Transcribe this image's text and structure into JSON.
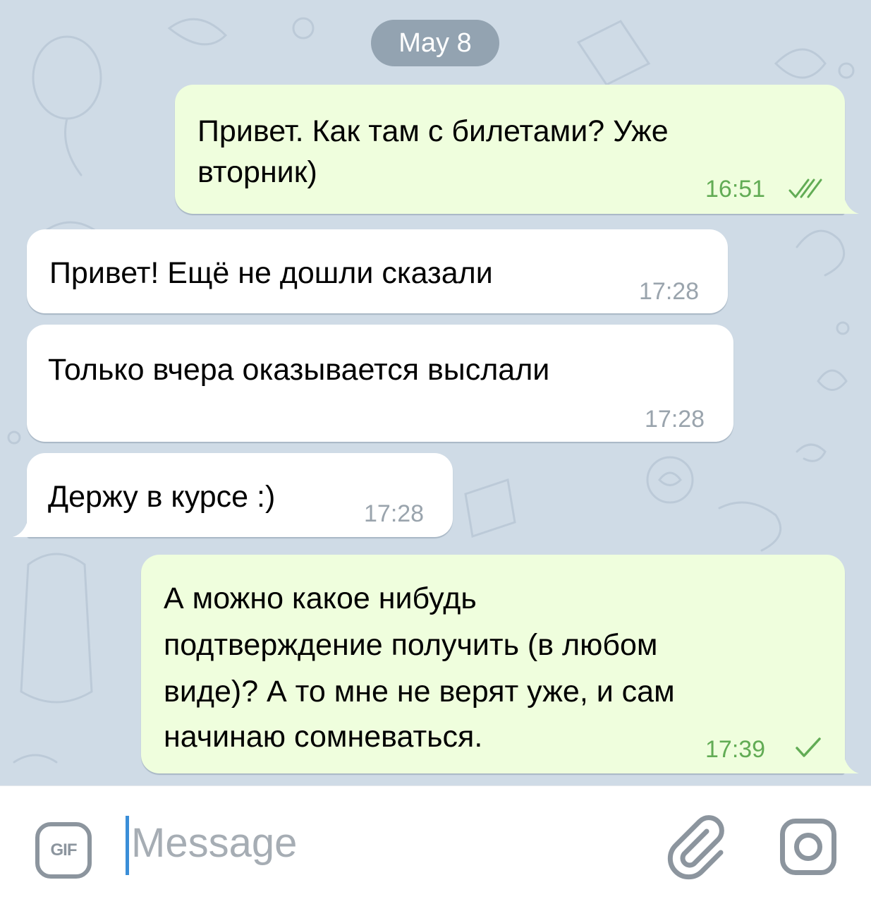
{
  "date_separator": "May 8",
  "messages": [
    {
      "direction": "outgoing",
      "lines": [
        "Привет. Как там с билетами? Уже",
        "вторник)"
      ],
      "time": "16:51",
      "status": "read"
    },
    {
      "direction": "incoming",
      "lines": [
        "Привет! Ещё не дошли сказали"
      ],
      "time": "17:28"
    },
    {
      "direction": "incoming",
      "lines": [
        "Только вчера оказывается выслали"
      ],
      "time": "17:28"
    },
    {
      "direction": "incoming",
      "lines": [
        "Держу в курсе :)"
      ],
      "time": "17:28"
    },
    {
      "direction": "outgoing",
      "lines": [
        "А можно какое нибудь",
        "подтверждение получить (в любом",
        "виде)? А то мне не верят уже, и сам",
        "начинаю сомневаться."
      ],
      "time": "17:39",
      "status": "sent"
    }
  ],
  "composer": {
    "gif_label": "GIF",
    "placeholder": "Message",
    "attach_icon": "paperclip-icon",
    "camera_icon": "camera-icon"
  },
  "colors": {
    "chat_background": "#cfdbe6",
    "incoming_bubble": "#ffffff",
    "outgoing_bubble": "#effedd",
    "outgoing_time": "#62ac55",
    "incoming_time": "#9aa4ad",
    "date_pill": "#93a3b1",
    "caret": "#3a8ed8"
  }
}
